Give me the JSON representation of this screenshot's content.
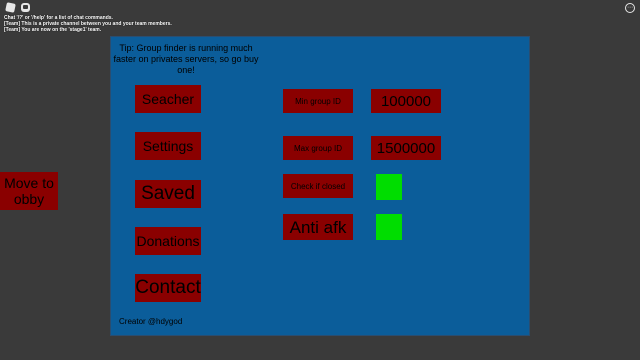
{
  "chat": {
    "lines": [
      "Chat '/?' or '/help' for a list of chat commands.",
      "[Team] This is a private channel between you and your team members.",
      "[Team] You are now on the 'stage1' team."
    ]
  },
  "sidebar": {
    "move_label": "Move to obby"
  },
  "panel": {
    "tip": "Tip: Group finder is running much faster on privates servers, so go buy one!",
    "nav": [
      "Seacher",
      "Settings",
      "Saved",
      "Donations",
      "Contact"
    ],
    "min_group_label": "Min group ID",
    "min_group_value": "100000",
    "max_group_label": "Max group ID",
    "max_group_value": "1500000",
    "check_closed_label": "Check if closed",
    "anti_afk_label": "Anti afk",
    "check_closed_enabled": true,
    "anti_afk_enabled": true,
    "creator": "Creator @hdygod"
  },
  "colors": {
    "panel_bg": "#0b5d9a",
    "button_bg": "#8a0000",
    "toggle_on": "#00dd00",
    "background": "#3a3a3a"
  },
  "icons": [
    "roblox-icon",
    "chat-icon",
    "menu-icon"
  ]
}
